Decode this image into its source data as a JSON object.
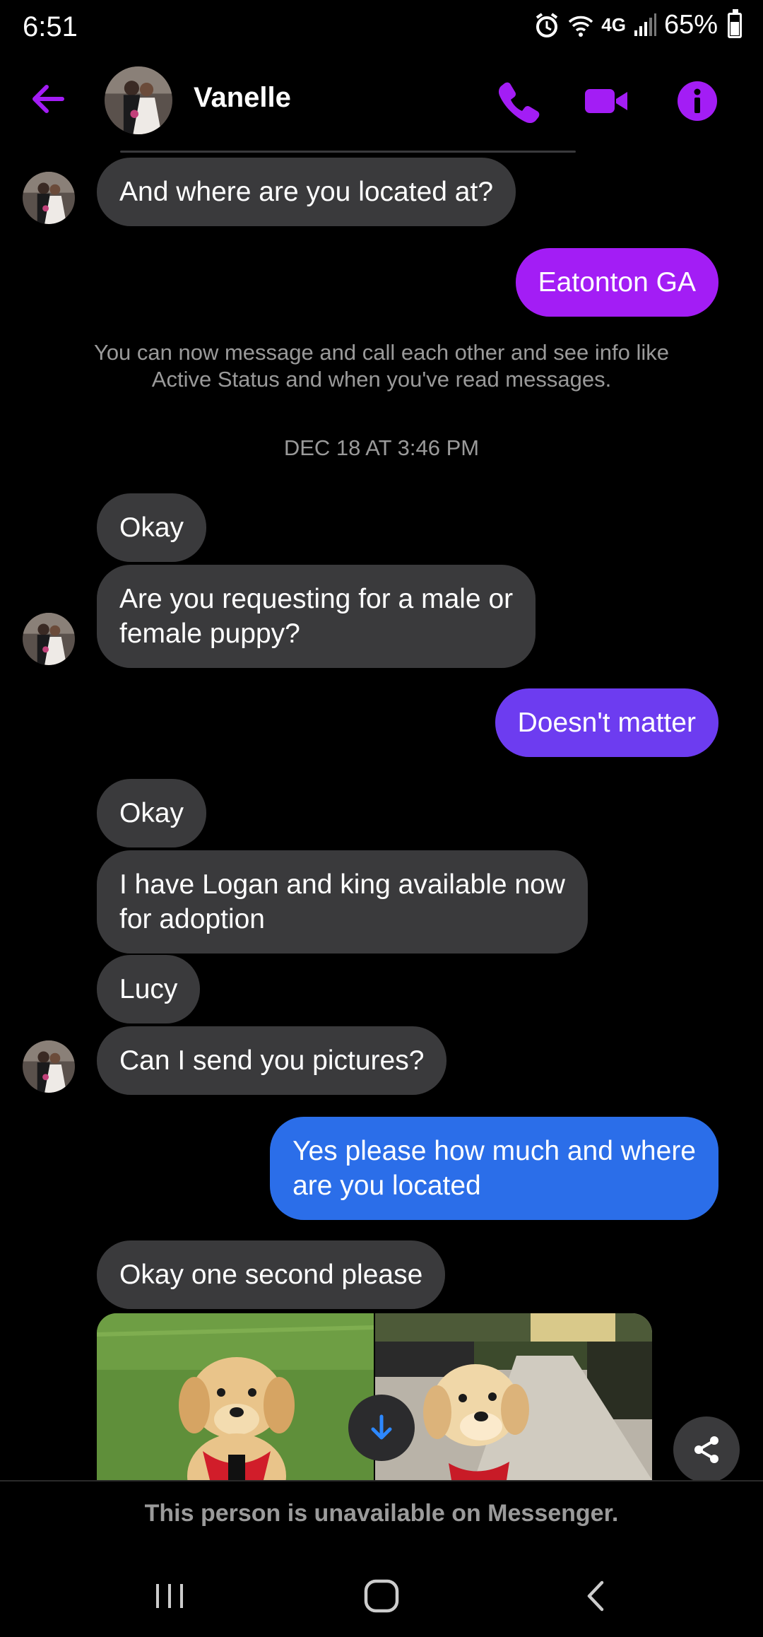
{
  "status": {
    "time": "6:51",
    "network": "4G",
    "battery": "65%"
  },
  "header": {
    "name": "Vanelle"
  },
  "messages": {
    "m1": "And where are you located at?",
    "m2": "Eatonton GA",
    "system": "You can now message and call each other and see info like Active Status and when you've read messages.",
    "timestamp": "DEC 18 AT 3:46 PM",
    "m3": "Okay",
    "m4": "Are you requesting for a male or\nfemale puppy?",
    "m5": "Doesn't matter",
    "m6": "Okay",
    "m7": "I have Logan and king available now\nfor adoption",
    "m8": "Lucy",
    "m9": "Can I send you pictures?",
    "m10": "Yes please how much and where\nare you located",
    "m11": "Okay one second please"
  },
  "footer": {
    "unavailable": "This person is unavailable on Messenger."
  },
  "colors": {
    "accent": "#a31df5",
    "incoming": "#3a3a3c",
    "outgoing_blue": "#2b6ee9",
    "outgoing_violet": "#6d3cf0"
  },
  "icons": [
    "back-arrow-icon",
    "phone-icon",
    "video-camera-icon",
    "info-icon",
    "arrow-down-icon",
    "share-icon",
    "recents-icon",
    "home-icon",
    "back-icon"
  ]
}
